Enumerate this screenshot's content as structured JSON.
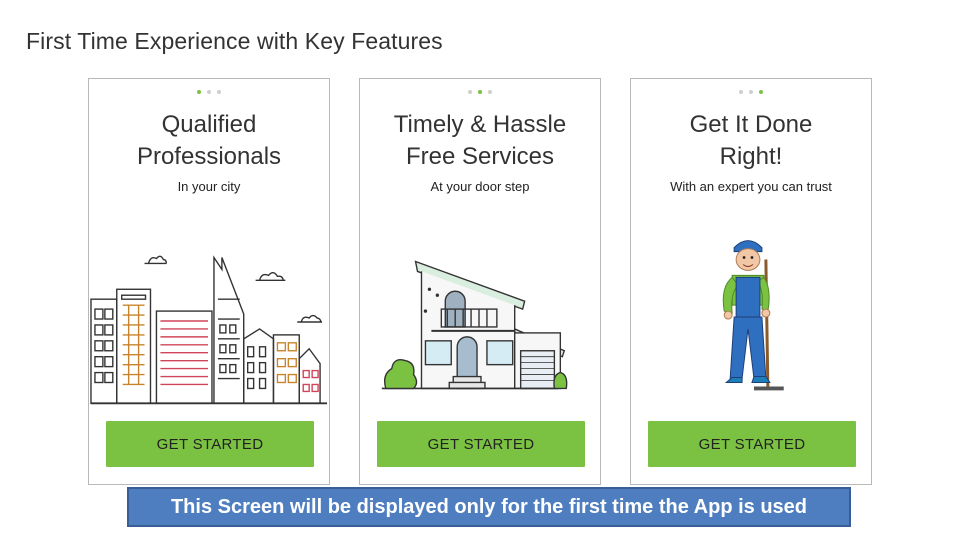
{
  "page_title": "First Time Experience with Key Features",
  "cards": [
    {
      "title_line1": "Qualified",
      "title_line2": "Professionals",
      "subtitle": "In your city",
      "button_label": "GET STARTED",
      "active_dot": 1,
      "illustration": "city-skyline-illustration"
    },
    {
      "title_line1": "Timely & Hassle",
      "title_line2": "Free Services",
      "subtitle": "At your door step",
      "button_label": "GET STARTED",
      "active_dot": 2,
      "illustration": "house-illustration"
    },
    {
      "title_line1": "Get It Done",
      "title_line2": "Right!",
      "subtitle": "With an expert you can trust",
      "button_label": "GET STARTED",
      "active_dot": 3,
      "illustration": "cleaner-worker-illustration"
    }
  ],
  "notice": "This Screen will be displayed only for the first time the App is used",
  "colors": {
    "accent": "#7cc242",
    "notice_bg": "#4f7ec0",
    "notice_border": "#375f95",
    "dot_inactive": "#cfcfcf"
  }
}
